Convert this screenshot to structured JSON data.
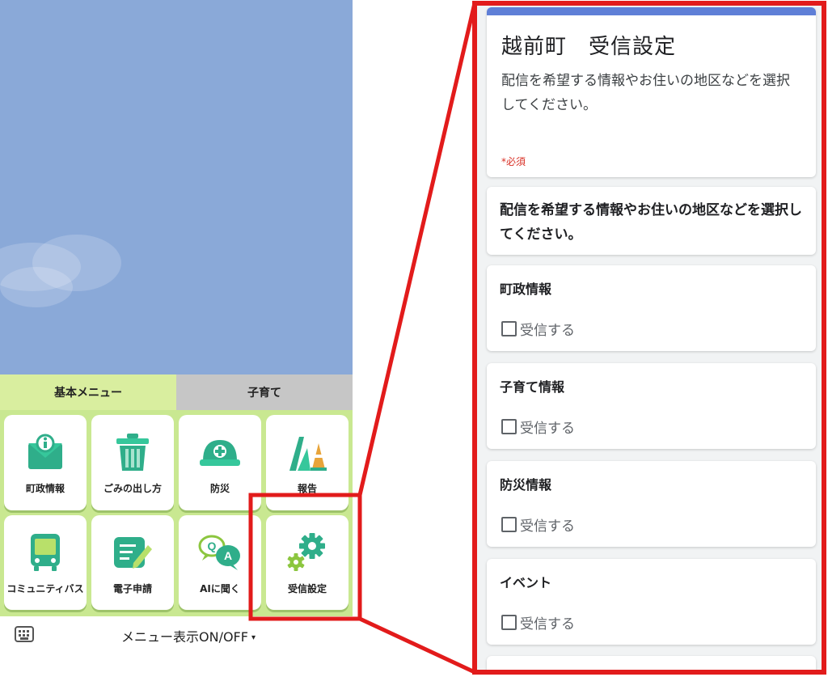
{
  "rich_menu": {
    "tabs": [
      {
        "label": "基本メニュー",
        "active": true
      },
      {
        "label": "子育て",
        "active": false
      }
    ],
    "items": [
      {
        "label": "町政情報",
        "icon": "mail-info-icon"
      },
      {
        "label": "ごみの出し方",
        "icon": "trash-can-icon"
      },
      {
        "label": "防災",
        "icon": "helmet-icon"
      },
      {
        "label": "報告",
        "icon": "road-cone-icon"
      },
      {
        "label": "コミュニティバス",
        "icon": "bus-icon"
      },
      {
        "label": "電子申請",
        "icon": "edit-form-icon"
      },
      {
        "label": "AIに聞く",
        "icon": "qa-chat-icon"
      },
      {
        "label": "受信設定",
        "icon": "gears-icon"
      }
    ],
    "toggle_label": "メニュー表示ON/OFF",
    "toggle_caret": "▾",
    "highlight_color": "#e21b1b"
  },
  "form": {
    "title": "越前町　受信設定",
    "description": "配信を希望する情報やお住いの地区などを選択してください。",
    "required_note": "*必須",
    "section_text": "配信を希望する情報やお住いの地区などを選択してください。",
    "questions": [
      {
        "title": "町政情報",
        "option": "受信する",
        "checked": false
      },
      {
        "title": "子育て情報",
        "option": "受信する",
        "checked": false
      },
      {
        "title": "防災情報",
        "option": "受信する",
        "checked": false
      },
      {
        "title": "イベント",
        "option": "受信する",
        "checked": false
      }
    ]
  }
}
